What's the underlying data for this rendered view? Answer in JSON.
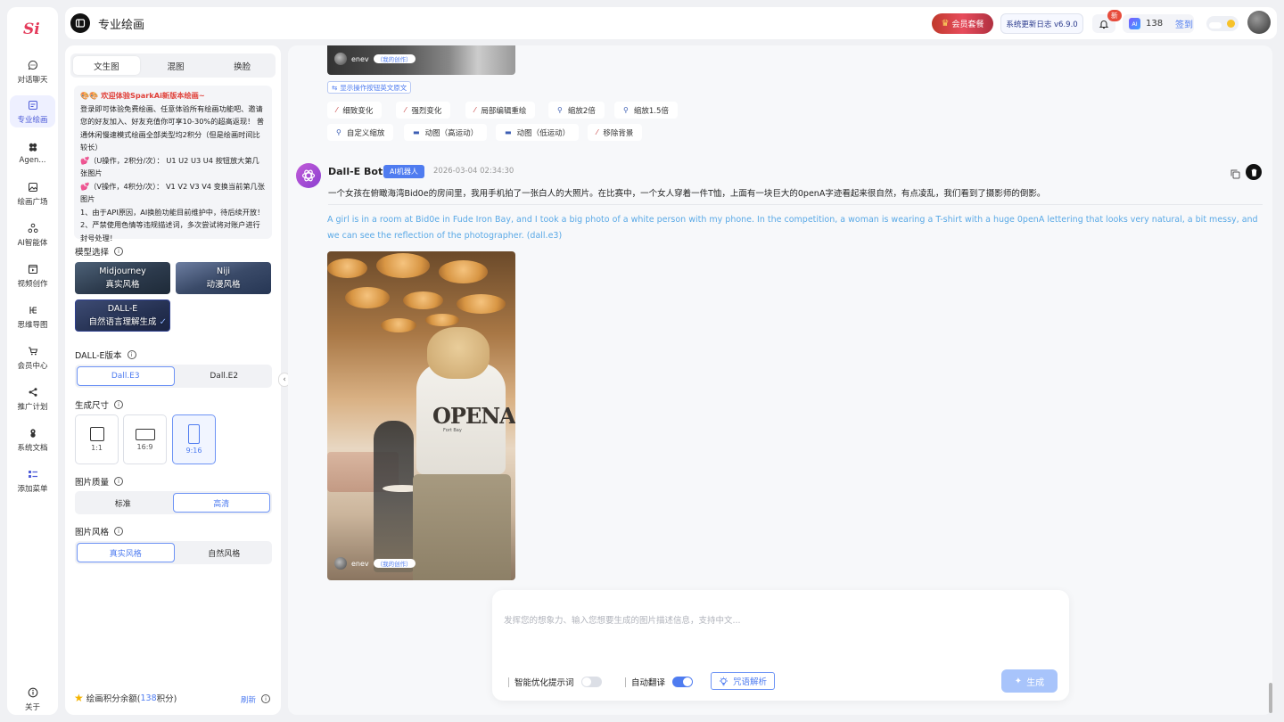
{
  "app": {
    "logo_text": "Si",
    "page_title": "专业绘画"
  },
  "nav": [
    {
      "label": "对话聊天",
      "icon": "chat-icon",
      "top": 0
    },
    {
      "label": "专业绘画",
      "icon": "paint-icon"
    },
    {
      "label": "Agen...",
      "icon": "agent-icon"
    },
    {
      "label": "绘画广场",
      "icon": "gallery-icon"
    },
    {
      "label": "AI智能体",
      "icon": "ai-agent-icon"
    },
    {
      "label": "视频创作",
      "icon": "video-icon"
    },
    {
      "label": "思维导图",
      "icon": "mindmap-icon"
    },
    {
      "label": "会员中心",
      "icon": "cart-icon"
    },
    {
      "label": "推广计划",
      "icon": "share-icon"
    },
    {
      "label": "系统文档",
      "icon": "doc-icon"
    },
    {
      "label": "添加菜单",
      "icon": "add-menu-icon"
    }
  ],
  "nav_about": "关于",
  "header": {
    "vip_label": "会员套餐",
    "update_label": "系统更新日志 v6.9.0",
    "new_badge": "新",
    "points": "138",
    "signin": "签到"
  },
  "panel": {
    "tabs": [
      "文生图",
      "混图",
      "换脸"
    ],
    "notice_title": "🎨🎨 欢迎体验SparkAi新版本绘画~",
    "notice_lines": [
      "登录即可体验免费绘画、任意体验所有绘画功能吧、邀请您的好友加入、好友充值你可享10-30%的超高返现！ 普通休闲慢速模式绘画全部类型均2积分（但是绘画时间比较长）",
      "💕（U操作，2积分/次）： U1 U2 U3 U4 按钮放大第几张图片",
      "💕（V操作，4积分/次）： V1 V2 V3 V4 变换当前第几张图片",
      "1、由于API原因，AI换脸功能目前维护中，待后续开放！",
      "2、严禁使用色情等违规描述词，多次尝试将对账户进行封号处理！"
    ],
    "model_label": "模型选择",
    "models": [
      {
        "name": "Midjourney",
        "sub": "真实风格"
      },
      {
        "name": "Niji",
        "sub": "动漫风格"
      },
      {
        "name": "DALL-E",
        "sub": "自然语言理解生成"
      }
    ],
    "dalle_version_label": "DALL-E版本",
    "dalle_versions": [
      "Dall.E3",
      "Dall.E2"
    ],
    "size_label": "生成尺寸",
    "sizes": [
      "1:1",
      "16:9",
      "9:16"
    ],
    "quality_label": "图片质量",
    "qualities": [
      "标准",
      "高清"
    ],
    "style_label": "图片风格",
    "styles": [
      "真实风格",
      "自然风格"
    ],
    "balance_prefix": "绘画积分余额(",
    "balance_value": "138",
    "balance_suffix": "积分)",
    "refresh": "刷新"
  },
  "chat": {
    "prev_author": "enev",
    "prev_tag": "（我的创作）",
    "show_original": "显示操作按钮英文原文",
    "actions_row1": [
      "细致变化",
      "强烈变化",
      "局部编辑重绘",
      "缩放2倍",
      "缩放1.5倍"
    ],
    "actions_row2": [
      "自定义缩放",
      "动图（高运动）",
      "动图（低运动）",
      "移除背景"
    ],
    "bot_name": "Dall-E Bot",
    "bot_badge": "AI机器人",
    "bot_time": "2026-03-04 02:34:30",
    "prompt_zh": "一个女孩在俯瞰海湾Bid0e的房间里，我用手机拍了一张白人的大照片。在比赛中，一个女人穿着一件T恤，上面有一块巨大的0penA字迹看起来很自然，有点凌乱，我们看到了摄影师的倒影。",
    "prompt_en": "A girl is in a room at Bid0e in Fude Iron Bay, and I took a big photo of a white person with my phone. In the competition, a woman is wearing a T-shirt with a huge 0penA lettering that looks very natural, a bit messy, and we can see the reflection of the photographer.  (dall.e3)",
    "image_text": "OPENA",
    "image_small_text": "Fort Bay",
    "author": "enev",
    "author_tag": "（我的创作）"
  },
  "composer": {
    "placeholder": "发挥您的想象力、输入您想要生成的图片描述信息，支持中文...",
    "smart_optimize": "智能优化提示词",
    "smart_optimize_on": false,
    "auto_translate": "自动翻译",
    "auto_translate_on": true,
    "parse_label": "咒语解析",
    "generate_label": "生成"
  }
}
